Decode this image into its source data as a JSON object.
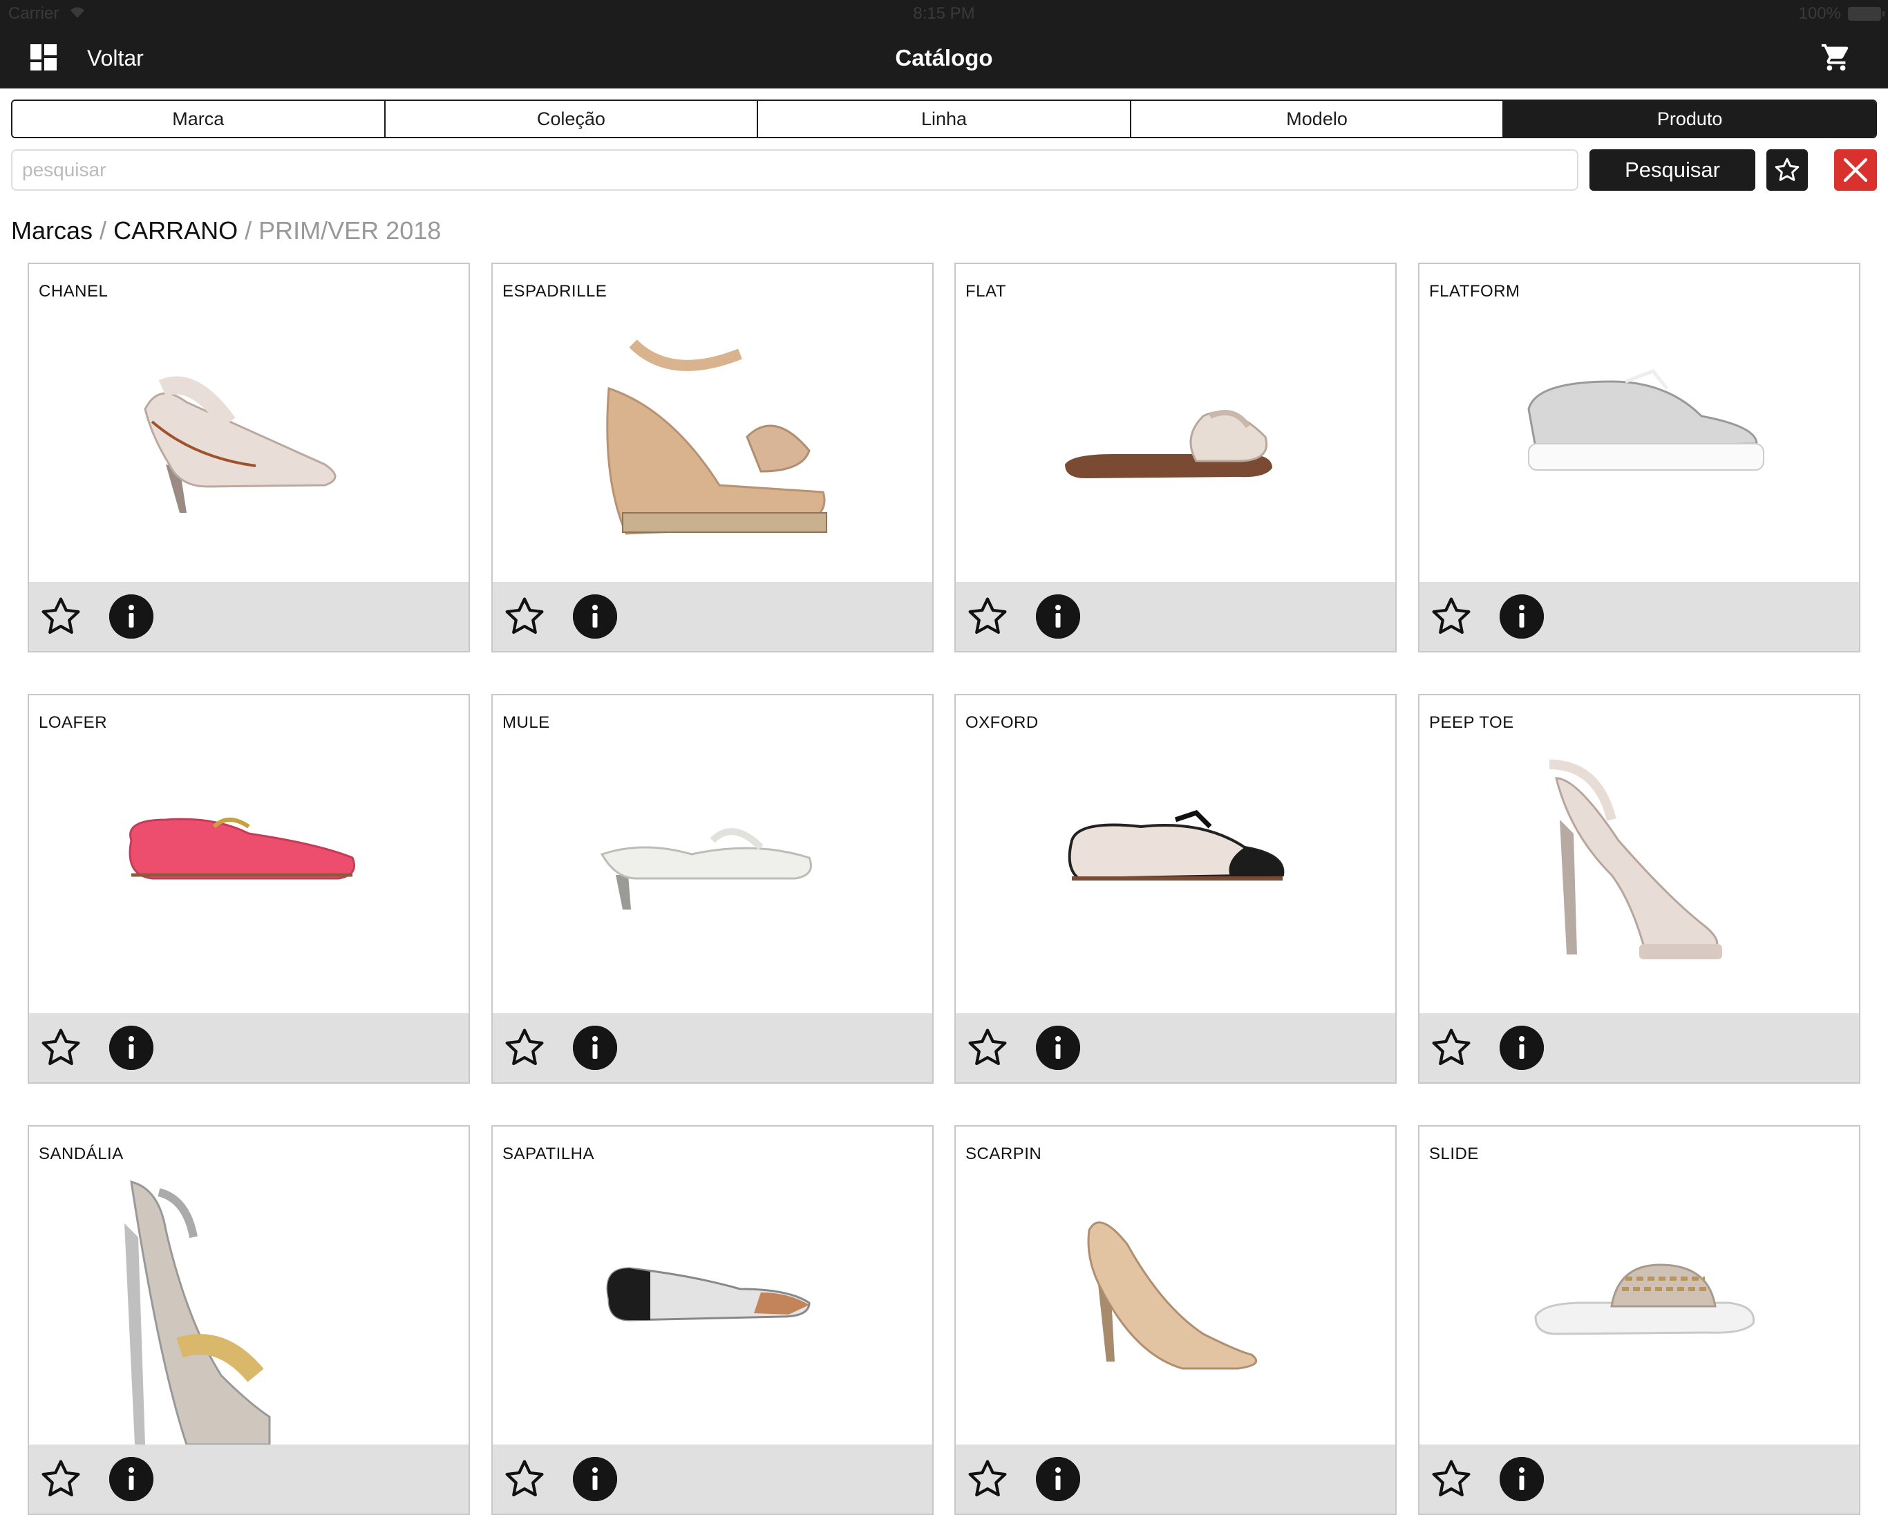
{
  "status_bar": {
    "carrier": "Carrier",
    "time": "8:15 PM",
    "battery": "100%"
  },
  "nav": {
    "back_label": "Voltar",
    "title": "Catálogo",
    "left_icon": "dashboard-grid-icon",
    "right_icon": "cart-icon"
  },
  "segments": [
    {
      "label": "Marca",
      "active": false
    },
    {
      "label": "Coleção",
      "active": false
    },
    {
      "label": "Linha",
      "active": false
    },
    {
      "label": "Modelo",
      "active": false
    },
    {
      "label": "Produto",
      "active": true
    }
  ],
  "search": {
    "placeholder": "pesquisar",
    "value": "",
    "button_label": "Pesquisar"
  },
  "breadcrumb": {
    "root": "Marcas",
    "separator": "/",
    "brand": "CARRANO",
    "collection": "PRIM/VER 2018"
  },
  "products": [
    {
      "name": "CHANEL",
      "shoe": "slingback",
      "color": "#e9ded7"
    },
    {
      "name": "ESPADRILLE",
      "shoe": "wedge",
      "color": "#d9b28e"
    },
    {
      "name": "FLAT",
      "shoe": "slide-bow",
      "color": "#e8ddd4"
    },
    {
      "name": "FLATFORM",
      "shoe": "oxford-platform",
      "color": "#d7d7d7"
    },
    {
      "name": "LOAFER",
      "shoe": "loafer",
      "color": "#ee4e6e"
    },
    {
      "name": "MULE",
      "shoe": "mule",
      "color": "#efefec"
    },
    {
      "name": "OXFORD",
      "shoe": "oxford-flat",
      "color": "#ece1da"
    },
    {
      "name": "PEEP TOE",
      "shoe": "peep-toe",
      "color": "#e8dcd6"
    },
    {
      "name": "SANDÁLIA",
      "shoe": "platform-sandal",
      "color": "#cfc7be"
    },
    {
      "name": "SAPATILHA",
      "shoe": "flat-pointed",
      "color": "#e3e3e3"
    },
    {
      "name": "SCARPIN",
      "shoe": "pump",
      "color": "#e2c3a2"
    },
    {
      "name": "SLIDE",
      "shoe": "slide",
      "color": "#f2f2f2"
    }
  ],
  "colors": {
    "bar": "#1c1c1c",
    "accent_red": "#d9312d",
    "footer_gray": "#e0e0e0"
  }
}
